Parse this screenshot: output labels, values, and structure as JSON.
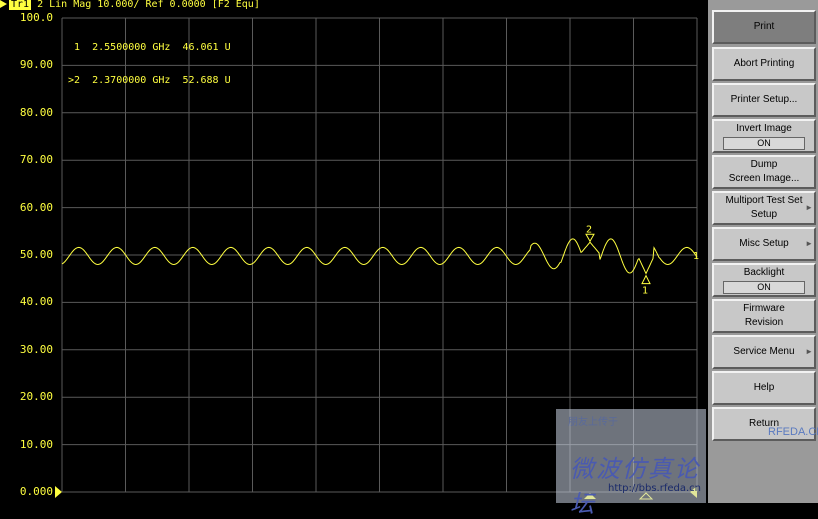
{
  "header": {
    "trace_tag": "Tr1",
    "trace_info": "2  Lin Mag  10.000/  Ref 0.0000  [F2 Equ]"
  },
  "plot": {
    "yticks": [
      "100.0",
      "90.00",
      "80.00",
      "70.00",
      "60.00",
      "50.00",
      "40.00",
      "30.00",
      "20.00",
      "10.00",
      "0.000"
    ],
    "colors": {
      "trace": "#ffff40",
      "grid": "#5a5a5a",
      "background": "#000000"
    }
  },
  "markers": {
    "readout": [
      {
        "id": "1",
        "prefix": " ",
        "freq": "2.5500000 GHz",
        "value": "46.061 U"
      },
      {
        "id": "2",
        "prefix": ">",
        "freq": "2.3700000 GHz",
        "value": "52.688 U"
      }
    ],
    "labels": {
      "m1": "1",
      "m2": "2",
      "ref": "1"
    }
  },
  "softkeys": [
    {
      "label": "Print"
    },
    {
      "label": "Abort Printing"
    },
    {
      "label": "Printer Setup..."
    },
    {
      "label": "Invert Image",
      "state": "ON"
    },
    {
      "label": "Dump",
      "label2": "Screen Image..."
    },
    {
      "label": "Multiport Test Set",
      "label2": "Setup",
      "arrow": "►"
    },
    {
      "label": "Misc Setup",
      "arrow": "►"
    },
    {
      "label": "Backlight",
      "state": "ON"
    },
    {
      "label": "Firmware",
      "label2": "Revision"
    },
    {
      "label": "Service Menu",
      "arrow": "►"
    },
    {
      "label": "Help"
    },
    {
      "label": "Return"
    }
  ],
  "watermark": {
    "small": "朋友上传于",
    "big": "微波仿真论坛",
    "url": "http://bbs.rfeda.cn",
    "logo": "RFEDA.CN"
  }
}
